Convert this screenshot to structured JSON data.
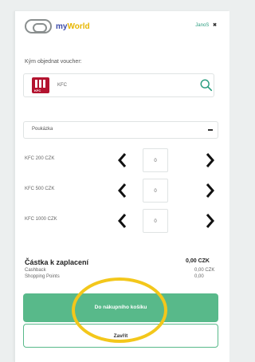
{
  "header": {
    "logo_my": "my",
    "logo_world": "World",
    "user_link": "JanoS",
    "close_glyph": "✖"
  },
  "shop": {
    "label": "Kým objednat voucher:",
    "value": "KFC",
    "brand_logo_text": "KFC"
  },
  "select": {
    "value": "Poukázka"
  },
  "items": [
    {
      "label": "KFC 200 CZK",
      "quantity": "0"
    },
    {
      "label": "KFC 500 CZK",
      "quantity": "0"
    },
    {
      "label": "KFC 1000 CZK",
      "quantity": "0"
    }
  ],
  "summary": {
    "title": "Částka k zaplacení",
    "amount": "0,00 CZK",
    "rows": [
      {
        "label": "Cashback",
        "value": "0,00 CZK"
      },
      {
        "label": "Shopping Points",
        "value": "0,00"
      }
    ]
  },
  "buttons": {
    "primary": "Do nákupního košíku",
    "secondary": "Zavřít"
  },
  "colors": {
    "accent": "#58b98a",
    "highlight": "#f3c71b",
    "brand_blue": "#3b4aa8",
    "brand_yellow": "#e7b600"
  },
  "icons": [
    "search-icon",
    "chevron-left-icon",
    "chevron-right-icon",
    "chevron-down-icon",
    "close-icon"
  ]
}
